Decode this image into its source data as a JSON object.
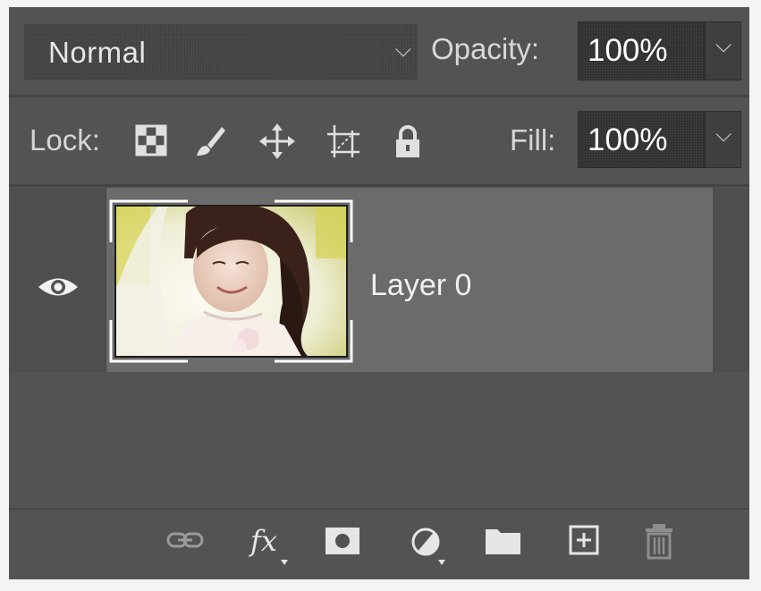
{
  "blend": {
    "mode": "Normal",
    "chevron": "chevron-down-icon"
  },
  "opacity": {
    "label": "Opacity:",
    "value": "100%"
  },
  "lock": {
    "label": "Lock:",
    "icons": [
      "lock-transparent-pixels-icon",
      "lock-image-pixels-icon",
      "lock-position-icon",
      "lock-artboard-icon",
      "lock-all-icon"
    ]
  },
  "fill": {
    "label": "Fill:",
    "value": "100%"
  },
  "layers": [
    {
      "name": "Layer 0",
      "visible": true,
      "selected": true
    }
  ],
  "footer": {
    "icons": [
      "link-layers-icon",
      "fx-layer-style-icon",
      "add-mask-icon",
      "adjustment-layer-icon",
      "new-group-icon",
      "new-layer-icon",
      "delete-icon"
    ]
  },
  "colors": {
    "panel": "#535353",
    "selected_row": "#6b6b6b",
    "text": "#e6e6e6"
  }
}
